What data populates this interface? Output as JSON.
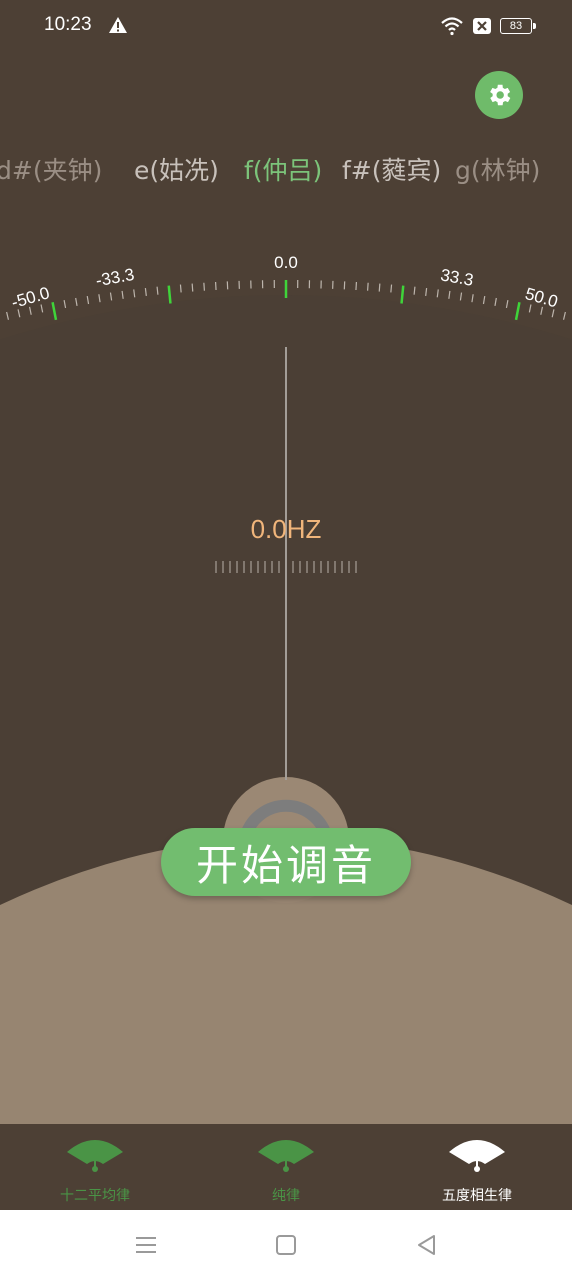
{
  "status_bar": {
    "time": "10:23",
    "battery": "83"
  },
  "notes": {
    "items": [
      {
        "label": "d#(夹钟)",
        "color": "#9a8e84"
      },
      {
        "label": "e(姑冼)",
        "color": "#c8c1bb"
      },
      {
        "label": "f(仲吕)",
        "color": "#7cc47a"
      },
      {
        "label": "f#(蕤宾)",
        "color": "#c8c1bb"
      },
      {
        "label": "g(林钟)",
        "color": "#9a8e84"
      }
    ]
  },
  "dial": {
    "labels": [
      "-50.0",
      "-33.3",
      "0.0",
      "33.3",
      "50.0"
    ]
  },
  "readout": {
    "frequency": "0.0HZ"
  },
  "start_button": {
    "label": "开始调音"
  },
  "bottom_nav": {
    "items": [
      {
        "label": "十二平均律",
        "active": false
      },
      {
        "label": "纯律",
        "active": false
      },
      {
        "label": "五度相生律",
        "active": true
      }
    ]
  },
  "colors": {
    "accent": "#72bd6f",
    "background": "#4d4035",
    "sand": "#978571",
    "frequency": "#f0b57b",
    "tick_green": "#3fd43a"
  },
  "icons": {
    "settings": "gear-icon",
    "alert": "warning-icon",
    "wifi": "wifi-icon",
    "nav_menu": "menu-icon",
    "nav_home": "square-icon",
    "nav_back": "triangle-back-icon"
  }
}
